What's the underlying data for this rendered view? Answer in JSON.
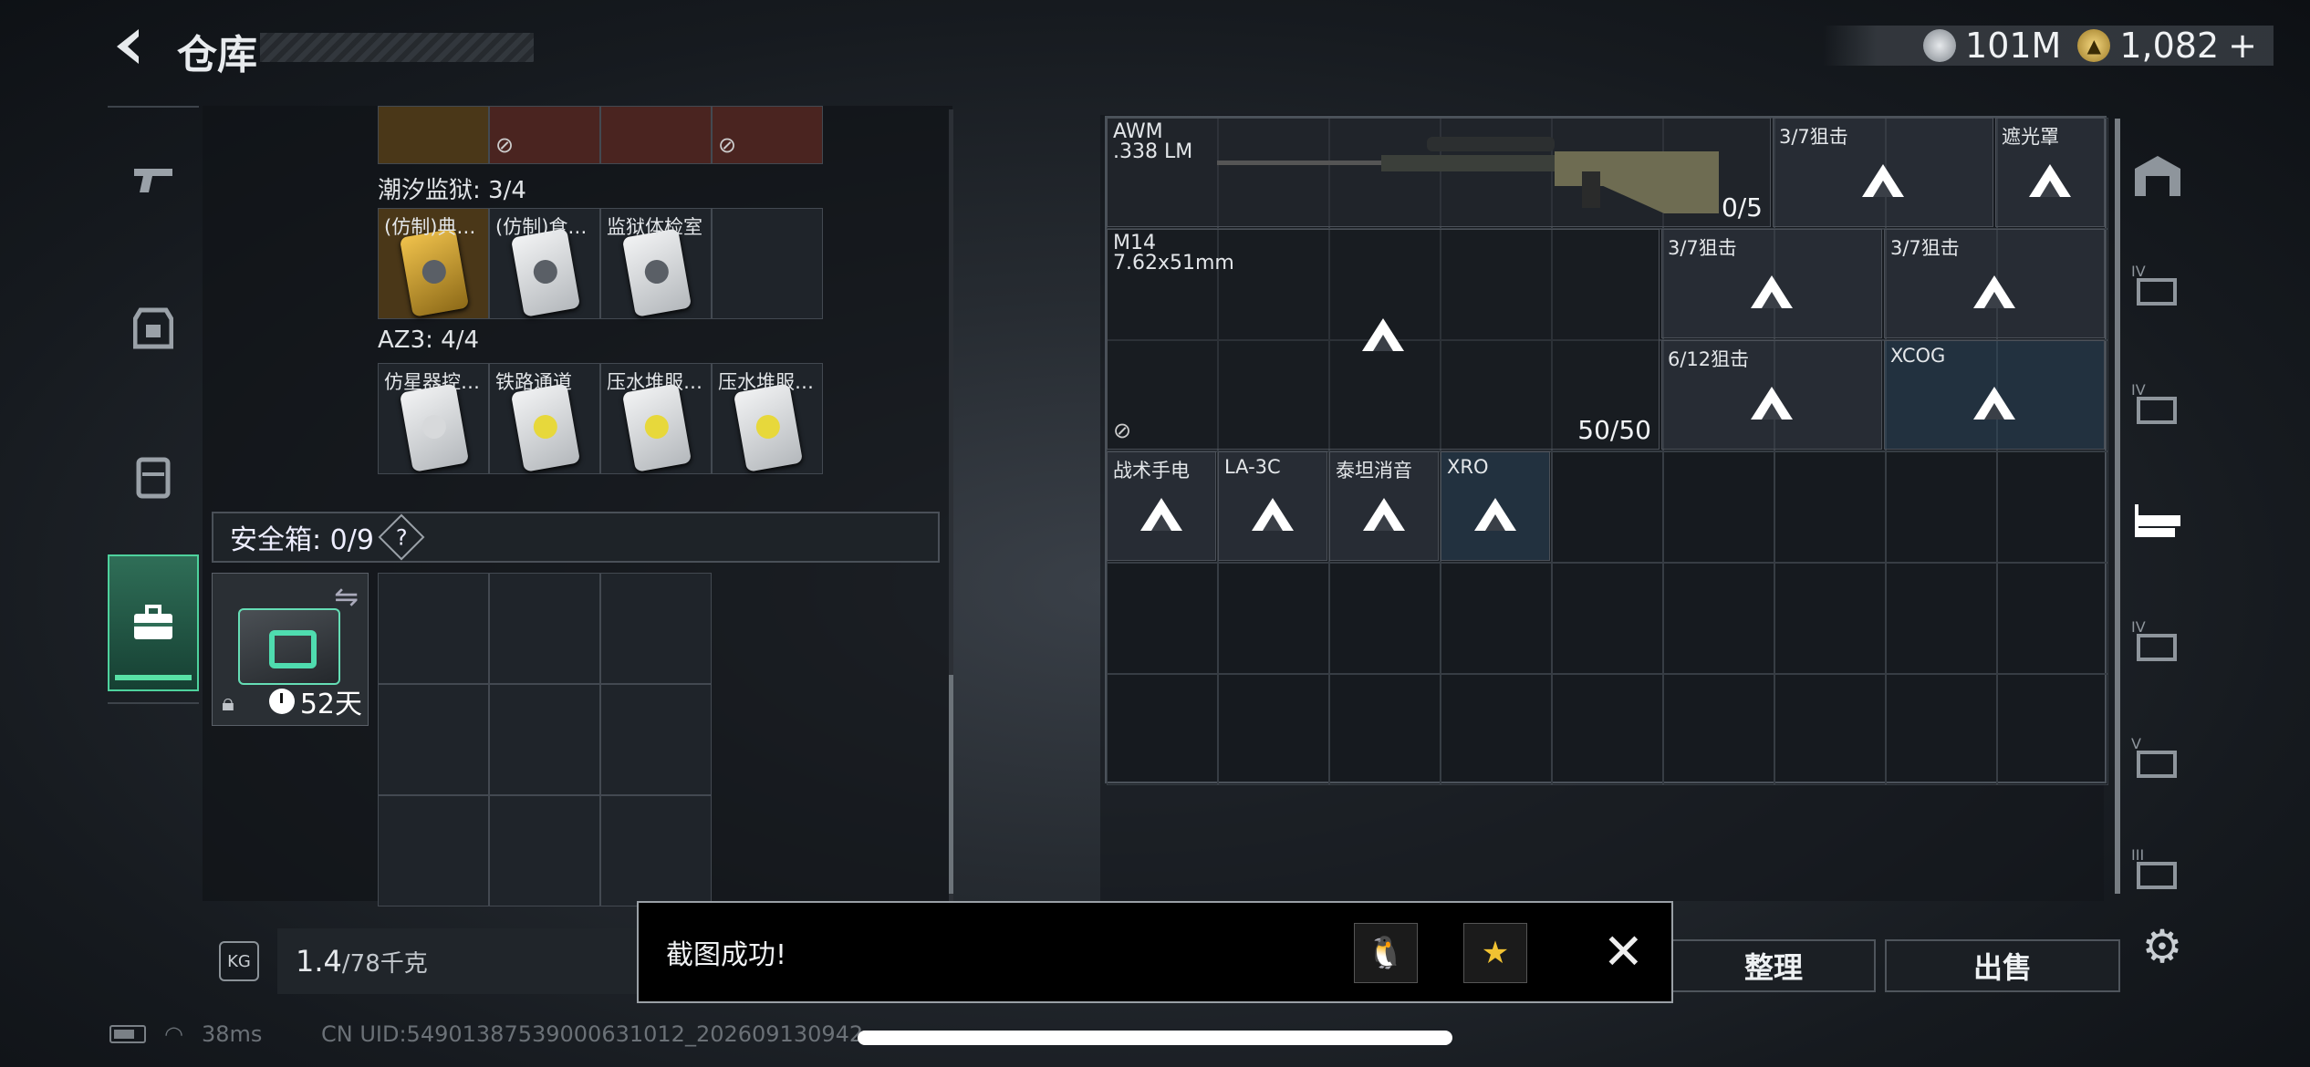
{
  "header": {
    "title": "仓库",
    "silver": "101M",
    "gold": "1,082",
    "plus": "+"
  },
  "nav": {
    "items": [
      "pistol-icon",
      "armor-icon",
      "backpack-icon",
      "safebox-icon"
    ]
  },
  "left": {
    "prison_label": "潮汐监狱: 3/4",
    "az3_label": "AZ3: 4/4",
    "top_row": [
      "",
      "",
      "",
      ""
    ],
    "prison_items": [
      "(仿制)典…",
      "(仿制)食…",
      "监狱体检室"
    ],
    "az3_items": [
      "仿星器控…",
      "铁路通道",
      "压水堆服…",
      "压水堆服…"
    ],
    "safe_label": "安全箱: 0/9",
    "safe_help": "?",
    "safe_days": "52天",
    "weight_value": "1.4",
    "weight_max": "/78千克",
    "weight_icon": "KG"
  },
  "weapons": {
    "awm_name": "AWM",
    "awm_ammo": ".338 LM",
    "awm_count": "0/5",
    "m14_name": "M14",
    "m14_ammo": "7.62x51mm",
    "m14_count": "50/50",
    "slots": [
      "3/7狙击",
      "遮光罩",
      "3/7狙击",
      "3/7狙击",
      "6/12狙击",
      "XCOG",
      "战术手电",
      "LA-3C",
      "泰坦消音",
      "XRO"
    ]
  },
  "buttons": {
    "sort": "整理",
    "sell": "出售"
  },
  "toast": {
    "text": "截图成功!"
  },
  "status": {
    "ping": "38ms",
    "uid": "CN UID:5490138753900063101​2_202609130942"
  }
}
